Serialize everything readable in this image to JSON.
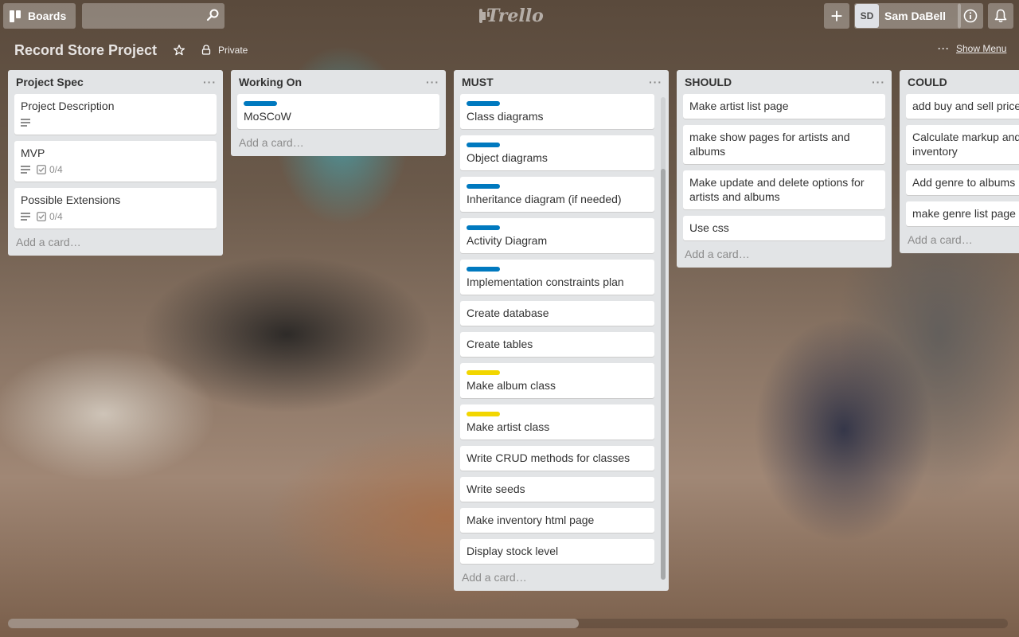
{
  "header": {
    "boards_label": "Boards",
    "search_placeholder": "",
    "logo_text": "Trello",
    "add_label": "+",
    "member_initials": "SD",
    "member_name": "Sam DaBell"
  },
  "board": {
    "title": "Record Store Project",
    "privacy": "Private",
    "menu_dots": "···",
    "show_menu": "Show Menu"
  },
  "colors": {
    "label_blue": "#0079bf",
    "label_yellow": "#f2d600"
  },
  "lists": [
    {
      "name": "Project Spec",
      "menu": "···",
      "add_card": "Add a card…",
      "cards": [
        {
          "title": "Project Description",
          "has_description": true
        },
        {
          "title": "MVP",
          "has_description": true,
          "checklist": "0/4"
        },
        {
          "title": "Possible Extensions",
          "has_description": true,
          "checklist": "0/4"
        }
      ]
    },
    {
      "name": "Working On",
      "menu": "···",
      "add_card": "Add a card…",
      "cards": [
        {
          "title": "MoSCoW",
          "label_color": "blue"
        }
      ]
    },
    {
      "name": "MUST",
      "menu": "···",
      "add_card": "Add a card…",
      "cards": [
        {
          "title": "Class diagrams",
          "label_color": "blue"
        },
        {
          "title": "Object diagrams",
          "label_color": "blue"
        },
        {
          "title": "Inheritance diagram (if needed)",
          "label_color": "blue"
        },
        {
          "title": "Activity Diagram",
          "label_color": "blue"
        },
        {
          "title": "Implementation constraints plan",
          "label_color": "blue"
        },
        {
          "title": "Create database"
        },
        {
          "title": "Create tables"
        },
        {
          "title": "Make album class",
          "label_color": "yellow"
        },
        {
          "title": "Make artist class",
          "label_color": "yellow"
        },
        {
          "title": "Write CRUD methods for classes"
        },
        {
          "title": "Write seeds"
        },
        {
          "title": "Make inventory html page"
        },
        {
          "title": "Display stock level"
        }
      ]
    },
    {
      "name": "SHOULD",
      "menu": "···",
      "add_card": "Add a card…",
      "cards": [
        {
          "title": "Make artist list page"
        },
        {
          "title": "make show pages for artists and albums"
        },
        {
          "title": "Make update and delete options for artists and albums"
        },
        {
          "title": "Use css"
        }
      ]
    },
    {
      "name": "COULD",
      "menu": "···",
      "add_card": "Add a card…",
      "cards": [
        {
          "title": "add buy and sell prices"
        },
        {
          "title": "Calculate markup and inventory"
        },
        {
          "title": "Add genre to albums"
        },
        {
          "title": "make genre list page"
        }
      ]
    }
  ]
}
